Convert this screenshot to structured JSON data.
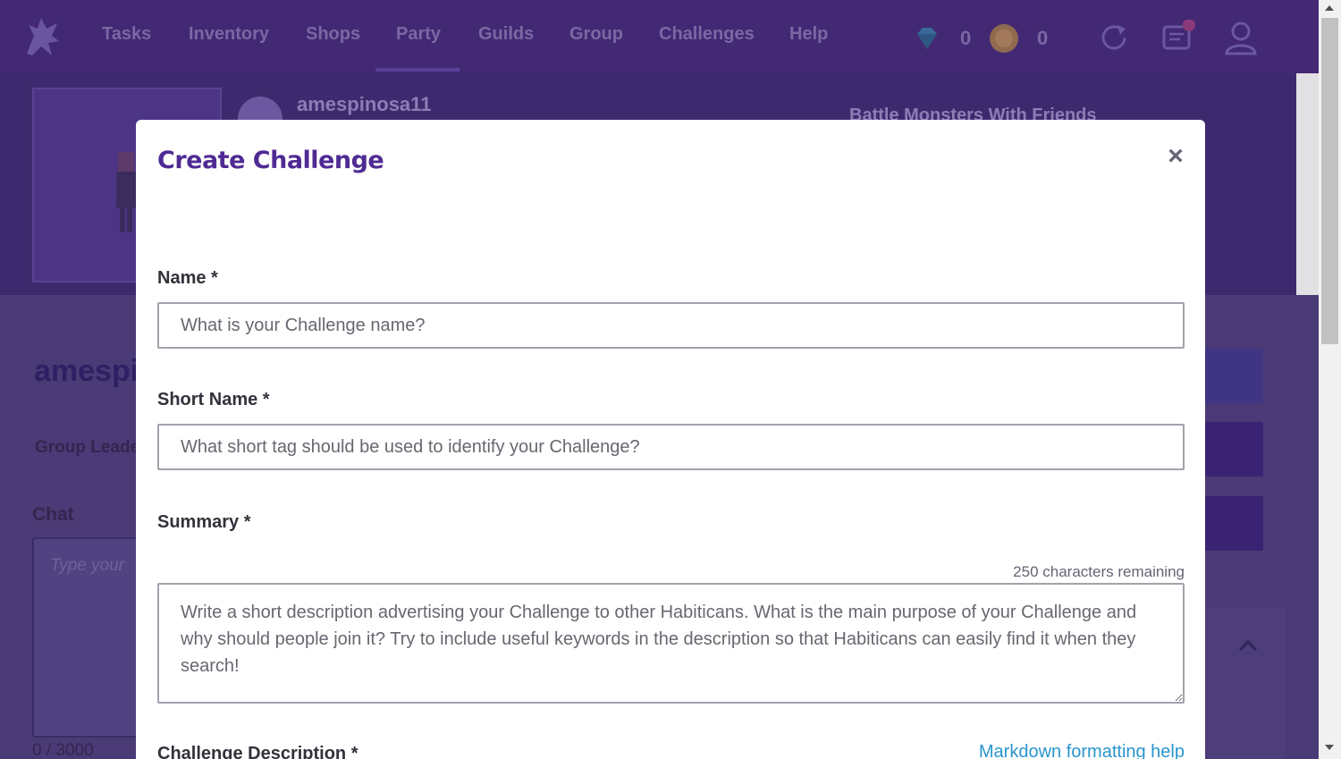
{
  "nav": {
    "items": [
      {
        "label": "Tasks"
      },
      {
        "label": "Inventory"
      },
      {
        "label": "Shops"
      },
      {
        "label": "Party"
      },
      {
        "label": "Guilds"
      },
      {
        "label": "Group"
      },
      {
        "label": "Challenges"
      },
      {
        "label": "Help"
      }
    ],
    "gems": "0",
    "gold": "0"
  },
  "party": {
    "username": "amespinosa11",
    "quest_title": "Battle Monsters With Friends",
    "group_name": "amespi",
    "group_leader_label": "Group Leade",
    "chat_heading": "Chat",
    "chat_placeholder": "Type your",
    "chat_count": "0 / 3000"
  },
  "modal": {
    "title": "Create Challenge",
    "close_label": "×",
    "name_label": "Name *",
    "name_placeholder": "What is your Challenge name?",
    "short_name_label": "Short Name *",
    "short_name_placeholder": "What short tag should be used to identify your Challenge?",
    "summary_label": "Summary *",
    "summary_remaining": "250 characters remaining",
    "summary_placeholder": "Write a short description advertising your Challenge to other Habiticans. What is the main purpose of your Challenge and why should people join it? Try to include useful keywords in the description so that Habiticans can easily find it when they search!",
    "description_label": "Challenge Description *",
    "markdown_help": "Markdown formatting help"
  },
  "colors": {
    "brand_purple": "#432874",
    "modal_title": "#4f2a93",
    "link_blue": "#2995cd"
  }
}
